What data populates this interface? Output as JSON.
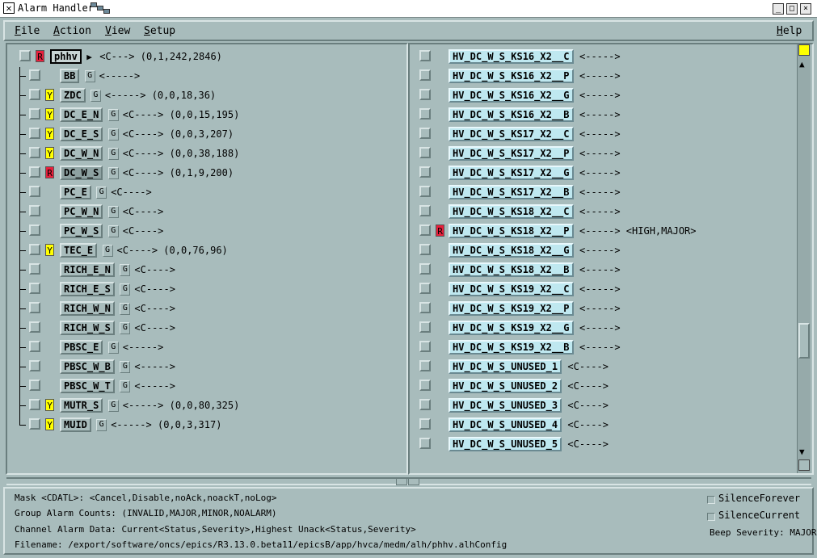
{
  "window": {
    "title": "Alarm Handler"
  },
  "menu": {
    "file": "File",
    "action": "Action",
    "view": "View",
    "setup": "Setup",
    "help": "Help"
  },
  "groups": [
    {
      "name": "phhv",
      "sev": "R",
      "g": "",
      "arrow": true,
      "info": "<C---> (0,1,242,2846)"
    },
    {
      "name": "BB",
      "sev": "",
      "g": "G",
      "info": "<----->"
    },
    {
      "name": "ZDC",
      "sev": "Y",
      "g": "G",
      "info": "<-----> (0,0,18,36)"
    },
    {
      "name": "DC_E_N",
      "sev": "Y",
      "g": "G",
      "info": "<C----> (0,0,15,195)"
    },
    {
      "name": "DC_E_S",
      "sev": "Y",
      "g": "G",
      "info": "<C----> (0,0,3,207)"
    },
    {
      "name": "DC_W_N",
      "sev": "Y",
      "g": "G",
      "info": "<C----> (0,0,38,188)"
    },
    {
      "name": "DC_W_S",
      "sev": "R",
      "g": "G",
      "info": "<C----> (0,1,9,200)"
    },
    {
      "name": "PC_E",
      "sev": "",
      "g": "G",
      "info": "<C---->"
    },
    {
      "name": "PC_W_N",
      "sev": "",
      "g": "G",
      "info": "<C---->"
    },
    {
      "name": "PC_W_S",
      "sev": "",
      "g": "G",
      "info": "<C---->"
    },
    {
      "name": "TEC_E",
      "sev": "Y",
      "g": "G",
      "info": "<C----> (0,0,76,96)"
    },
    {
      "name": "RICH_E_N",
      "sev": "",
      "g": "G",
      "info": "<C---->"
    },
    {
      "name": "RICH_E_S",
      "sev": "",
      "g": "G",
      "info": "<C---->"
    },
    {
      "name": "RICH_W_N",
      "sev": "",
      "g": "G",
      "info": "<C---->"
    },
    {
      "name": "RICH_W_S",
      "sev": "",
      "g": "G",
      "info": "<C---->"
    },
    {
      "name": "PBSC_E",
      "sev": "",
      "g": "G",
      "info": "<----->"
    },
    {
      "name": "PBSC_W_B",
      "sev": "",
      "g": "G",
      "info": "<----->"
    },
    {
      "name": "PBSC_W_T",
      "sev": "",
      "g": "G",
      "info": "<----->"
    },
    {
      "name": "MUTR_S",
      "sev": "Y",
      "g": "G",
      "info": "<-----> (0,0,80,325)"
    },
    {
      "name": "MUID",
      "sev": "Y",
      "g": "G",
      "info": "<-----> (0,0,3,317)"
    }
  ],
  "channels": [
    {
      "name": "HV_DC_W_S_KS16_X2__C",
      "sev": "",
      "info": "<----->"
    },
    {
      "name": "HV_DC_W_S_KS16_X2__P",
      "sev": "",
      "info": "<----->"
    },
    {
      "name": "HV_DC_W_S_KS16_X2__G",
      "sev": "",
      "info": "<----->"
    },
    {
      "name": "HV_DC_W_S_KS16_X2__B",
      "sev": "",
      "info": "<----->"
    },
    {
      "name": "HV_DC_W_S_KS17_X2__C",
      "sev": "",
      "info": "<----->"
    },
    {
      "name": "HV_DC_W_S_KS17_X2__P",
      "sev": "",
      "info": "<----->"
    },
    {
      "name": "HV_DC_W_S_KS17_X2__G",
      "sev": "",
      "info": "<----->"
    },
    {
      "name": "HV_DC_W_S_KS17_X2__B",
      "sev": "",
      "info": "<----->"
    },
    {
      "name": "HV_DC_W_S_KS18_X2__C",
      "sev": "",
      "info": "<----->"
    },
    {
      "name": "HV_DC_W_S_KS18_X2__P",
      "sev": "R",
      "info": "<-----> <HIGH,MAJOR>"
    },
    {
      "name": "HV_DC_W_S_KS18_X2__G",
      "sev": "",
      "info": "<----->"
    },
    {
      "name": "HV_DC_W_S_KS18_X2__B",
      "sev": "",
      "info": "<----->"
    },
    {
      "name": "HV_DC_W_S_KS19_X2__C",
      "sev": "",
      "info": "<----->"
    },
    {
      "name": "HV_DC_W_S_KS19_X2__P",
      "sev": "",
      "info": "<----->"
    },
    {
      "name": "HV_DC_W_S_KS19_X2__G",
      "sev": "",
      "info": "<----->"
    },
    {
      "name": "HV_DC_W_S_KS19_X2__B",
      "sev": "",
      "info": "<----->"
    },
    {
      "name": "HV_DC_W_S_UNUSED_1",
      "sev": "",
      "info": "<C---->"
    },
    {
      "name": "HV_DC_W_S_UNUSED_2",
      "sev": "",
      "info": "<C---->"
    },
    {
      "name": "HV_DC_W_S_UNUSED_3",
      "sev": "",
      "info": "<C---->"
    },
    {
      "name": "HV_DC_W_S_UNUSED_4",
      "sev": "",
      "info": "<C---->"
    },
    {
      "name": "HV_DC_W_S_UNUSED_5",
      "sev": "",
      "info": "<C---->"
    }
  ],
  "status": {
    "mask": "Mask <CDATL>: <Cancel,Disable,noAck,noackT,noLog>",
    "group_counts": "Group Alarm Counts: (INVALID,MAJOR,MINOR,NOALARM)",
    "channel_data": "Channel Alarm Data: Current<Status,Severity>,Highest Unack<Status,Severity>",
    "filename": "Filename: /export/software/oncs/epics/R3.13.0.beta11/epicsB/app/hvca/medm/alh/phhv.alhConfig",
    "silence_forever": "SilenceForever",
    "silence_current": "SilenceCurrent",
    "beep_severity": "Beep Severity: MAJOR"
  },
  "colors": {
    "background": "#a8bcbc",
    "minor": "#ffff00",
    "major": "#e8203c",
    "channel": "#bfe8f0"
  }
}
